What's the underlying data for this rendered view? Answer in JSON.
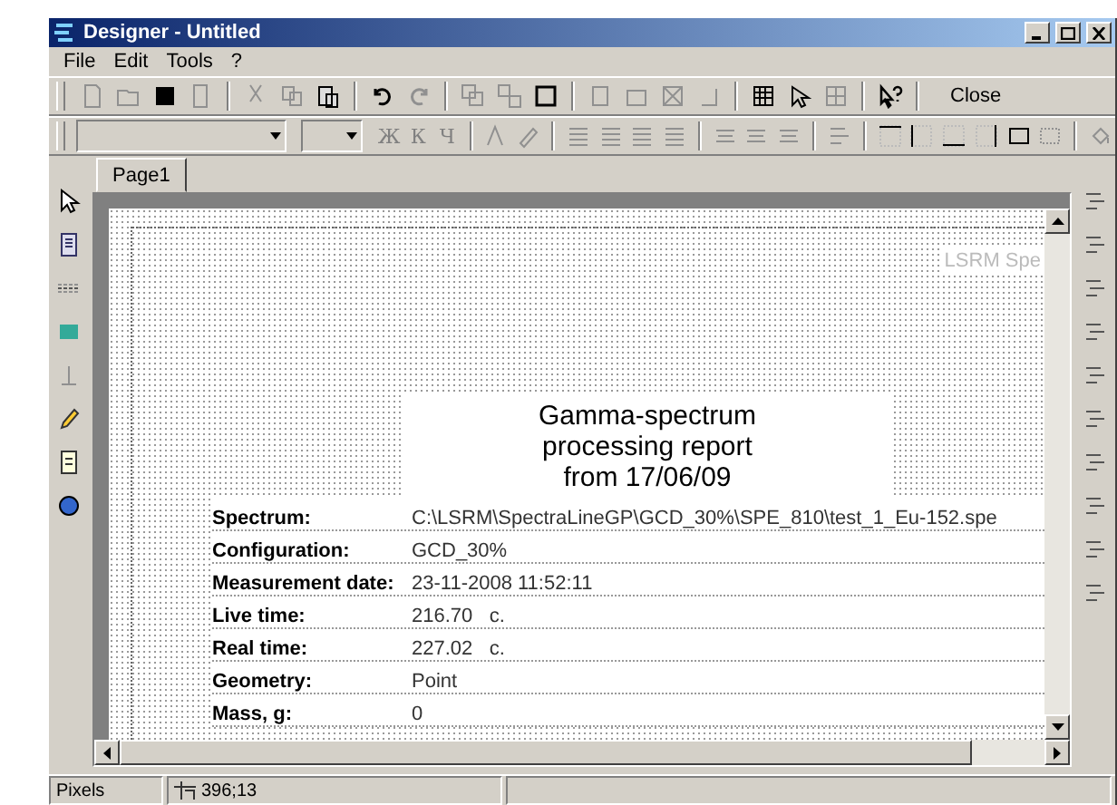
{
  "window": {
    "title": "Designer - Untitled"
  },
  "menu": [
    "File",
    "Edit",
    "Tools",
    "?"
  ],
  "toolbar": {
    "close_label": "Close"
  },
  "format_toolbar": {
    "style_buttons": [
      "Ж",
      "К",
      "Ч"
    ]
  },
  "tabs": [
    {
      "label": "Page1",
      "selected": true
    }
  ],
  "page": {
    "header_text": "LSRM Spe",
    "report_title": "Gamma-spectrum\nprocessing report\nfrom 17/06/09",
    "rows": [
      {
        "label": "Spectrum:",
        "value": "C:\\LSRM\\SpectraLineGP\\GCD_30%\\SPE_810\\test_1_Eu-152.spe"
      },
      {
        "label": "Configuration:",
        "value": "GCD_30%"
      },
      {
        "label": "Measurement date:",
        "value": "23-11-2008 11:52:11"
      },
      {
        "label": "Live time:",
        "value": "216.70   c."
      },
      {
        "label": "Real time:",
        "value": "227.02   c."
      },
      {
        "label": "Geometry:",
        "value": "Point"
      },
      {
        "label": "Mass, g:",
        "value": "0"
      }
    ]
  },
  "status_bar": {
    "units": "Pixels",
    "position": "396;13"
  }
}
